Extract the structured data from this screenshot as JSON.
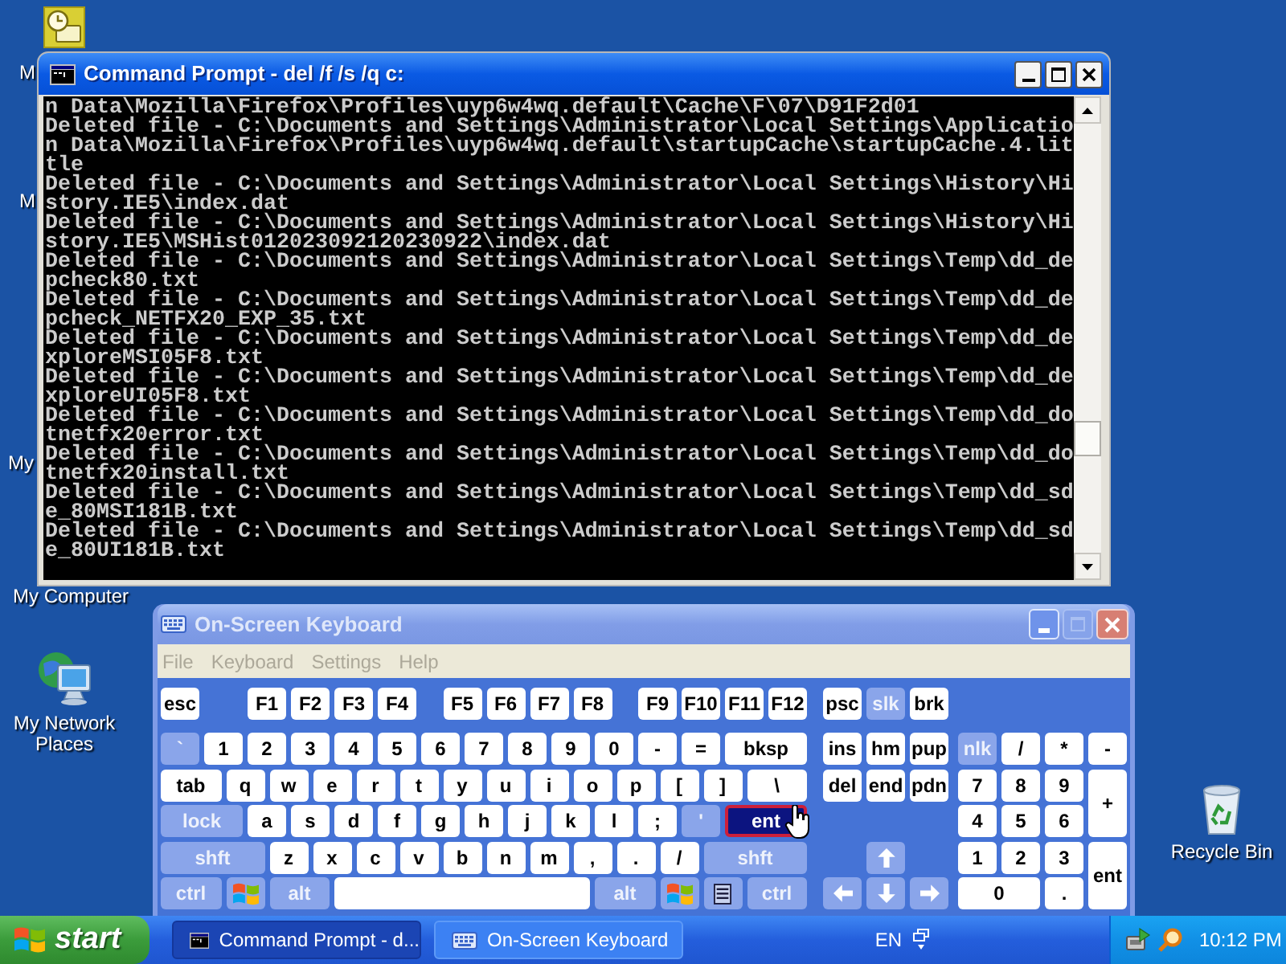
{
  "desktop": {
    "labels": [
      "M",
      "M",
      "My",
      "My Computer"
    ],
    "icons": [
      {
        "kind": "network",
        "label": "My Network Places"
      },
      {
        "kind": "recycle",
        "label": "Recycle Bin"
      }
    ]
  },
  "command_prompt": {
    "title": "Command Prompt - del /f /s /q c:",
    "active": true,
    "lines": [
      "n Data\\Mozilla\\Firefox\\Profiles\\uyp6w4wq.default\\Cache\\F\\07\\D91F2d01",
      "Deleted file - C:\\Documents and Settings\\Administrator\\Local Settings\\Applicatio",
      "n Data\\Mozilla\\Firefox\\Profiles\\uyp6w4wq.default\\startupCache\\startupCache.4.lit",
      "tle",
      "Deleted file - C:\\Documents and Settings\\Administrator\\Local Settings\\History\\Hi",
      "story.IE5\\index.dat",
      "Deleted file - C:\\Documents and Settings\\Administrator\\Local Settings\\History\\Hi",
      "story.IE5\\MSHist012023092120230922\\index.dat",
      "Deleted file - C:\\Documents and Settings\\Administrator\\Local Settings\\Temp\\dd_de",
      "pcheck80.txt",
      "Deleted file - C:\\Documents and Settings\\Administrator\\Local Settings\\Temp\\dd_de",
      "pcheck_NETFX20_EXP_35.txt",
      "Deleted file - C:\\Documents and Settings\\Administrator\\Local Settings\\Temp\\dd_de",
      "xploreMSI05F8.txt",
      "Deleted file - C:\\Documents and Settings\\Administrator\\Local Settings\\Temp\\dd_de",
      "xploreUI05F8.txt",
      "Deleted file - C:\\Documents and Settings\\Administrator\\Local Settings\\Temp\\dd_do",
      "tnetfx20error.txt",
      "Deleted file - C:\\Documents and Settings\\Administrator\\Local Settings\\Temp\\dd_do",
      "tnetfx20install.txt",
      "Deleted file - C:\\Documents and Settings\\Administrator\\Local Settings\\Temp\\dd_sd",
      "e_80MSI181B.txt",
      "Deleted file - C:\\Documents and Settings\\Administrator\\Local Settings\\Temp\\dd_sd",
      "e_80UI181B.txt"
    ]
  },
  "keyboard_window": {
    "title": "On-Screen Keyboard",
    "active": false,
    "menu": [
      "File",
      "Keyboard",
      "Settings",
      "Help"
    ],
    "key_rows": [
      {
        "keys": [
          {
            "label": "esc",
            "kind": "key",
            "selected": false
          },
          {
            "label": "F1",
            "kind": "key",
            "selected": false
          },
          {
            "label": "F2",
            "kind": "key",
            "selected": false
          },
          {
            "label": "F3",
            "kind": "key",
            "selected": false
          },
          {
            "label": "F4",
            "kind": "key",
            "selected": false
          },
          {
            "label": "F5",
            "kind": "key",
            "selected": false
          },
          {
            "label": "F6",
            "kind": "key",
            "selected": false
          },
          {
            "label": "F7",
            "kind": "key",
            "selected": false
          },
          {
            "label": "F8",
            "kind": "key",
            "selected": false
          },
          {
            "label": "F9",
            "kind": "key",
            "selected": false
          },
          {
            "label": "F10",
            "kind": "key",
            "selected": false
          },
          {
            "label": "F11",
            "kind": "key",
            "selected": false
          },
          {
            "label": "F12",
            "kind": "key",
            "selected": false
          },
          {
            "label": "psc",
            "kind": "key",
            "selected": false
          },
          {
            "label": "slk",
            "kind": "mod",
            "selected": false
          },
          {
            "label": "brk",
            "kind": "key",
            "selected": false
          }
        ]
      },
      {
        "keys": [
          {
            "label": "`",
            "kind": "mod",
            "selected": false
          },
          {
            "label": "1",
            "kind": "key",
            "selected": false
          },
          {
            "label": "2",
            "kind": "key",
            "selected": false
          },
          {
            "label": "3",
            "kind": "key",
            "selected": false
          },
          {
            "label": "4",
            "kind": "key",
            "selected": false
          },
          {
            "label": "5",
            "kind": "key",
            "selected": false
          },
          {
            "label": "6",
            "kind": "key",
            "selected": false
          },
          {
            "label": "7",
            "kind": "key",
            "selected": false
          },
          {
            "label": "8",
            "kind": "key",
            "selected": false
          },
          {
            "label": "9",
            "kind": "key",
            "selected": false
          },
          {
            "label": "0",
            "kind": "key",
            "selected": false
          },
          {
            "label": "-",
            "kind": "key",
            "selected": false
          },
          {
            "label": "=",
            "kind": "key",
            "selected": false
          },
          {
            "label": "bksp",
            "kind": "key",
            "selected": false
          },
          {
            "label": "ins",
            "kind": "key",
            "selected": false
          },
          {
            "label": "hm",
            "kind": "key",
            "selected": false
          },
          {
            "label": "pup",
            "kind": "key",
            "selected": false
          },
          {
            "label": "nlk",
            "kind": "mod",
            "selected": false
          },
          {
            "label": "/",
            "kind": "key",
            "selected": false
          },
          {
            "label": "*",
            "kind": "key",
            "selected": false
          },
          {
            "label": "-",
            "kind": "key",
            "selected": false
          }
        ]
      },
      {
        "keys": [
          {
            "label": "tab",
            "kind": "key",
            "selected": false
          },
          {
            "label": "q",
            "kind": "key",
            "selected": false
          },
          {
            "label": "w",
            "kind": "key",
            "selected": false
          },
          {
            "label": "e",
            "kind": "key",
            "selected": false
          },
          {
            "label": "r",
            "kind": "key",
            "selected": false
          },
          {
            "label": "t",
            "kind": "key",
            "selected": false
          },
          {
            "label": "y",
            "kind": "key",
            "selected": false
          },
          {
            "label": "u",
            "kind": "key",
            "selected": false
          },
          {
            "label": "i",
            "kind": "key",
            "selected": false
          },
          {
            "label": "o",
            "kind": "key",
            "selected": false
          },
          {
            "label": "p",
            "kind": "key",
            "selected": false
          },
          {
            "label": "[",
            "kind": "key",
            "selected": false
          },
          {
            "label": "]",
            "kind": "key",
            "selected": false
          },
          {
            "label": "\\",
            "kind": "key",
            "selected": false
          },
          {
            "label": "del",
            "kind": "key",
            "selected": false
          },
          {
            "label": "end",
            "kind": "key",
            "selected": false
          },
          {
            "label": "pdn",
            "kind": "key",
            "selected": false
          },
          {
            "label": "7",
            "kind": "key",
            "selected": false
          },
          {
            "label": "8",
            "kind": "key",
            "selected": false
          },
          {
            "label": "9",
            "kind": "key",
            "selected": false
          },
          {
            "label": "+",
            "kind": "key",
            "selected": false
          }
        ]
      },
      {
        "keys": [
          {
            "label": "lock",
            "kind": "mod",
            "selected": false
          },
          {
            "label": "a",
            "kind": "key",
            "selected": false
          },
          {
            "label": "s",
            "kind": "key",
            "selected": false
          },
          {
            "label": "d",
            "kind": "key",
            "selected": false
          },
          {
            "label": "f",
            "kind": "key",
            "selected": false
          },
          {
            "label": "g",
            "kind": "key",
            "selected": false
          },
          {
            "label": "h",
            "kind": "key",
            "selected": false
          },
          {
            "label": "j",
            "kind": "key",
            "selected": false
          },
          {
            "label": "k",
            "kind": "key",
            "selected": false
          },
          {
            "label": "l",
            "kind": "key",
            "selected": false
          },
          {
            "label": ";",
            "kind": "key",
            "selected": false
          },
          {
            "label": "'",
            "kind": "mod",
            "selected": false
          },
          {
            "label": "ent",
            "kind": "key",
            "selected": true
          },
          {
            "label": "4",
            "kind": "key",
            "selected": false
          },
          {
            "label": "5",
            "kind": "key",
            "selected": false
          },
          {
            "label": "6",
            "kind": "key",
            "selected": false
          }
        ]
      },
      {
        "keys": [
          {
            "label": "shft",
            "kind": "mod",
            "selected": false
          },
          {
            "label": "z",
            "kind": "key",
            "selected": false
          },
          {
            "label": "x",
            "kind": "key",
            "selected": false
          },
          {
            "label": "c",
            "kind": "key",
            "selected": false
          },
          {
            "label": "v",
            "kind": "key",
            "selected": false
          },
          {
            "label": "b",
            "kind": "key",
            "selected": false
          },
          {
            "label": "n",
            "kind": "key",
            "selected": false
          },
          {
            "label": "m",
            "kind": "key",
            "selected": false
          },
          {
            "label": ",",
            "kind": "key",
            "selected": false
          },
          {
            "label": ".",
            "kind": "key",
            "selected": false
          },
          {
            "label": "/",
            "kind": "key",
            "selected": false
          },
          {
            "label": "shft",
            "kind": "mod",
            "selected": false
          },
          {
            "kind": "up",
            "selected": false
          },
          {
            "label": "1",
            "kind": "key",
            "selected": false
          },
          {
            "label": "2",
            "kind": "key",
            "selected": false
          },
          {
            "label": "3",
            "kind": "key",
            "selected": false
          },
          {
            "label": "ent",
            "kind": "key",
            "selected": false
          }
        ]
      },
      {
        "keys": [
          {
            "label": "ctrl",
            "kind": "mod",
            "selected": false
          },
          {
            "kind": "win",
            "selected": false
          },
          {
            "label": "alt",
            "kind": "mod",
            "selected": false
          },
          {
            "kind": "space",
            "selected": false
          },
          {
            "label": "alt",
            "kind": "mod",
            "selected": false
          },
          {
            "kind": "win",
            "selected": false
          },
          {
            "kind": "menu",
            "selected": false
          },
          {
            "label": "ctrl",
            "kind": "mod",
            "selected": false
          },
          {
            "kind": "left",
            "selected": false
          },
          {
            "kind": "down",
            "selected": false
          },
          {
            "kind": "right",
            "selected": false
          },
          {
            "label": "0",
            "kind": "key",
            "selected": false
          },
          {
            "label": ".",
            "kind": "key",
            "selected": false
          }
        ]
      }
    ]
  },
  "taskbar": {
    "start": "start",
    "tasks": [
      {
        "kind": "console",
        "label": "Command Prompt - d...",
        "selected": true
      },
      {
        "kind": "keyboard",
        "label": "On-Screen Keyboard",
        "selected": false
      }
    ],
    "language": "EN",
    "clock": "10:12 PM"
  }
}
